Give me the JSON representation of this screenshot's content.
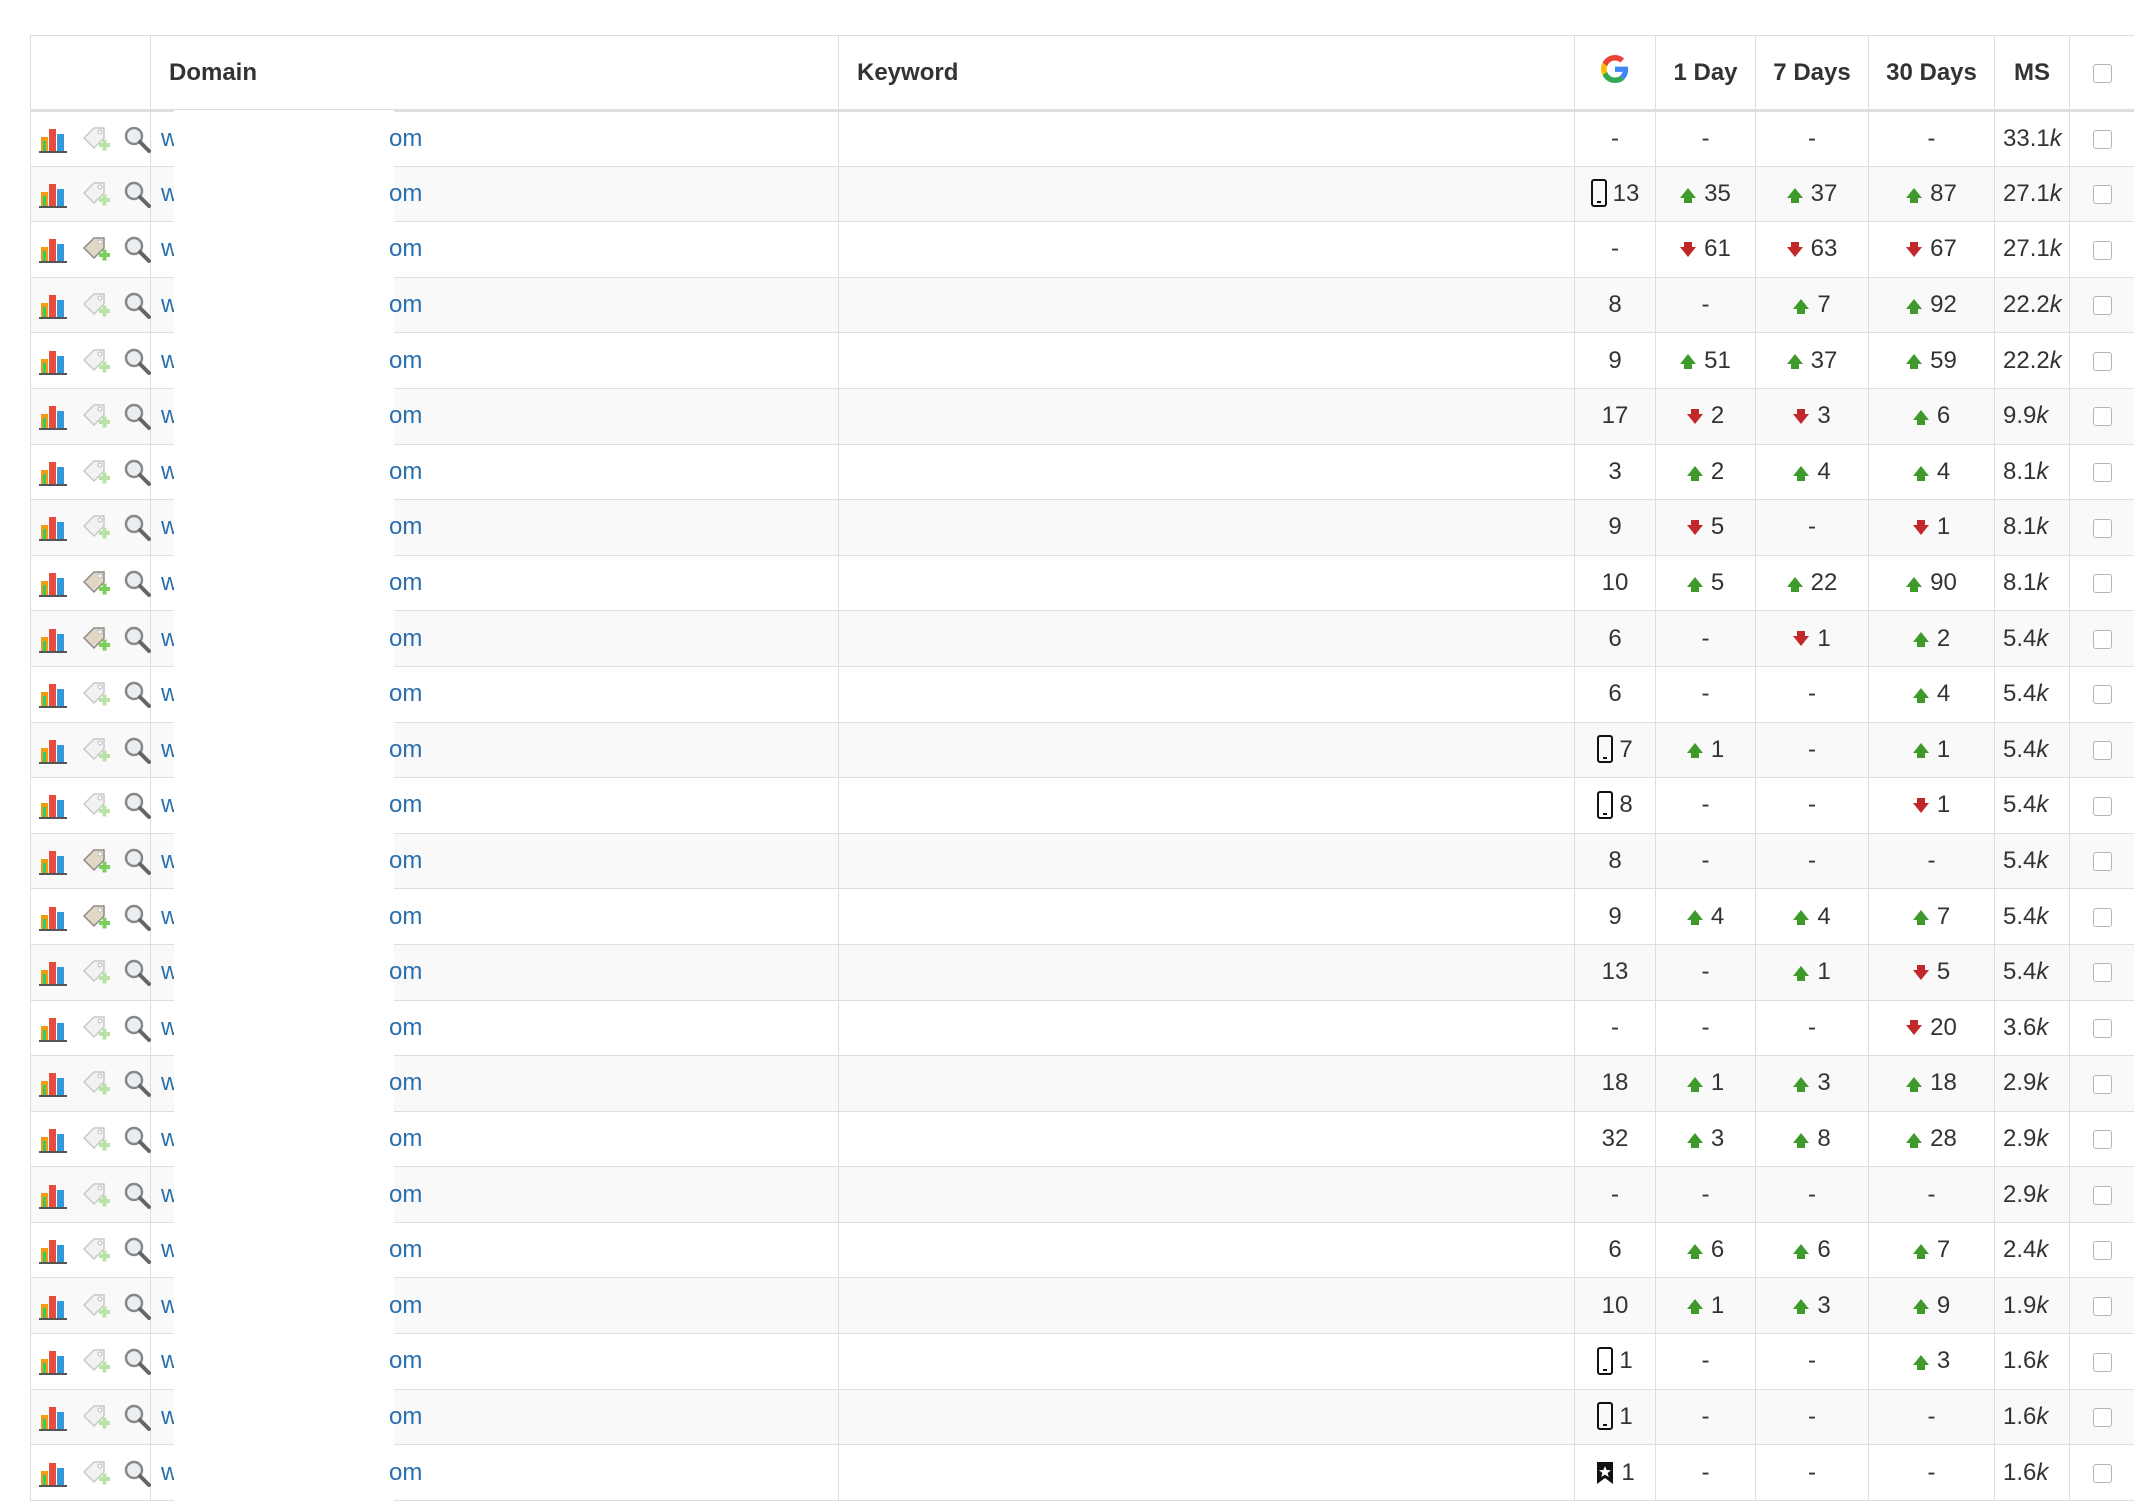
{
  "header": {
    "domain": "Domain",
    "keyword": "Keyword",
    "google_icon": "google-icon",
    "day1": "1 Day",
    "day7": "7 Days",
    "day30": "30 Days",
    "ms": "MS"
  },
  "colors": {
    "up": "#3f9a2c",
    "down": "#c0282a",
    "link": "#2a6fad"
  },
  "rows": [
    {
      "d1": "w",
      "d2": "om",
      "g": "-",
      "gi": "",
      "o": "-",
      "od": "",
      "s": "-",
      "sd": "",
      "t": "-",
      "td": "",
      "ms": "33.1",
      "msu": "k",
      "add": "light"
    },
    {
      "d1": "w",
      "d2": "om",
      "g": "13",
      "gi": "mobile",
      "o": "35",
      "od": "up",
      "s": "37",
      "sd": "up",
      "t": "87",
      "td": "up",
      "ms": "27.1",
      "msu": "k",
      "add": "light"
    },
    {
      "d1": "w",
      "d2": "om",
      "g": "-",
      "gi": "",
      "o": "61",
      "od": "down",
      "s": "63",
      "sd": "down",
      "t": "67",
      "td": "down",
      "ms": "27.1",
      "msu": "k",
      "add": "dark"
    },
    {
      "d1": "w",
      "d2": "om",
      "g": "8",
      "gi": "",
      "o": "-",
      "od": "",
      "s": "7",
      "sd": "up",
      "t": "92",
      "td": "up",
      "ms": "22.2",
      "msu": "k",
      "add": "light"
    },
    {
      "d1": "w",
      "d2": "om",
      "g": "9",
      "gi": "",
      "o": "51",
      "od": "up",
      "s": "37",
      "sd": "up",
      "t": "59",
      "td": "up",
      "ms": "22.2",
      "msu": "k",
      "add": "light"
    },
    {
      "d1": "w",
      "d2": "om",
      "g": "17",
      "gi": "",
      "o": "2",
      "od": "down",
      "s": "3",
      "sd": "down",
      "t": "6",
      "td": "up",
      "ms": "9.9",
      "msu": "k",
      "add": "light"
    },
    {
      "d1": "w",
      "d2": "om",
      "g": "3",
      "gi": "",
      "o": "2",
      "od": "up",
      "s": "4",
      "sd": "up",
      "t": "4",
      "td": "up",
      "ms": "8.1",
      "msu": "k",
      "add": "light"
    },
    {
      "d1": "w",
      "d2": "om",
      "g": "9",
      "gi": "",
      "o": "5",
      "od": "down",
      "s": "-",
      "sd": "",
      "t": "1",
      "td": "down",
      "ms": "8.1",
      "msu": "k",
      "add": "light"
    },
    {
      "d1": "w",
      "d2": "om",
      "g": "10",
      "gi": "",
      "o": "5",
      "od": "up",
      "s": "22",
      "sd": "up",
      "t": "90",
      "td": "up",
      "ms": "8.1",
      "msu": "k",
      "add": "dark"
    },
    {
      "d1": "w",
      "d2": "om",
      "g": "6",
      "gi": "",
      "o": "-",
      "od": "",
      "s": "1",
      "sd": "down",
      "t": "2",
      "td": "up",
      "ms": "5.4",
      "msu": "k",
      "add": "dark"
    },
    {
      "d1": "w",
      "d2": "om",
      "g": "6",
      "gi": "",
      "o": "-",
      "od": "",
      "s": "-",
      "sd": "",
      "t": "4",
      "td": "up",
      "ms": "5.4",
      "msu": "k",
      "add": "light"
    },
    {
      "d1": "w",
      "d2": "om",
      "g": "7",
      "gi": "mobile",
      "o": "1",
      "od": "up",
      "s": "-",
      "sd": "",
      "t": "1",
      "td": "up",
      "ms": "5.4",
      "msu": "k",
      "add": "light"
    },
    {
      "d1": "w",
      "d2": "om",
      "g": "8",
      "gi": "mobile",
      "o": "-",
      "od": "",
      "s": "-",
      "sd": "",
      "t": "1",
      "td": "down",
      "ms": "5.4",
      "msu": "k",
      "add": "light"
    },
    {
      "d1": "w",
      "d2": "om",
      "g": "8",
      "gi": "",
      "o": "-",
      "od": "",
      "s": "-",
      "sd": "",
      "t": "-",
      "td": "",
      "ms": "5.4",
      "msu": "k",
      "add": "dark"
    },
    {
      "d1": "w",
      "d2": "om",
      "g": "9",
      "gi": "",
      "o": "4",
      "od": "up",
      "s": "4",
      "sd": "up",
      "t": "7",
      "td": "up",
      "ms": "5.4",
      "msu": "k",
      "add": "dark"
    },
    {
      "d1": "w",
      "d2": "om",
      "g": "13",
      "gi": "",
      "o": "-",
      "od": "",
      "s": "1",
      "sd": "up",
      "t": "5",
      "td": "down",
      "ms": "5.4",
      "msu": "k",
      "add": "light"
    },
    {
      "d1": "w",
      "d2": "om",
      "g": "-",
      "gi": "",
      "o": "-",
      "od": "",
      "s": "-",
      "sd": "",
      "t": "20",
      "td": "down",
      "ms": "3.6",
      "msu": "k",
      "add": "light"
    },
    {
      "d1": "w",
      "d2": "om",
      "g": "18",
      "gi": "",
      "o": "1",
      "od": "up",
      "s": "3",
      "sd": "up",
      "t": "18",
      "td": "up",
      "ms": "2.9",
      "msu": "k",
      "add": "light"
    },
    {
      "d1": "w",
      "d2": "om",
      "g": "32",
      "gi": "",
      "o": "3",
      "od": "up",
      "s": "8",
      "sd": "up",
      "t": "28",
      "td": "up",
      "ms": "2.9",
      "msu": "k",
      "add": "light"
    },
    {
      "d1": "w",
      "d2": "om",
      "g": "-",
      "gi": "",
      "o": "-",
      "od": "",
      "s": "-",
      "sd": "",
      "t": "-",
      "td": "",
      "ms": "2.9",
      "msu": "k",
      "add": "light"
    },
    {
      "d1": "w",
      "d2": "om",
      "g": "6",
      "gi": "",
      "o": "6",
      "od": "up",
      "s": "6",
      "sd": "up",
      "t": "7",
      "td": "up",
      "ms": "2.4",
      "msu": "k",
      "add": "light"
    },
    {
      "d1": "w",
      "d2": "om",
      "g": "10",
      "gi": "",
      "o": "1",
      "od": "up",
      "s": "3",
      "sd": "up",
      "t": "9",
      "td": "up",
      "ms": "1.9",
      "msu": "k",
      "add": "light"
    },
    {
      "d1": "w",
      "d2": "om",
      "g": "1",
      "gi": "mobile",
      "o": "-",
      "od": "",
      "s": "-",
      "sd": "",
      "t": "3",
      "td": "up",
      "ms": "1.6",
      "msu": "k",
      "add": "light"
    },
    {
      "d1": "w",
      "d2": "om",
      "g": "1",
      "gi": "mobile",
      "o": "-",
      "od": "",
      "s": "-",
      "sd": "",
      "t": "-",
      "td": "",
      "ms": "1.6",
      "msu": "k",
      "add": "light"
    },
    {
      "d1": "w",
      "d2": "om",
      "g": "1",
      "gi": "featured",
      "o": "-",
      "od": "",
      "s": "-",
      "sd": "",
      "t": "-",
      "td": "",
      "ms": "1.6",
      "msu": "k",
      "add": "light"
    }
  ]
}
